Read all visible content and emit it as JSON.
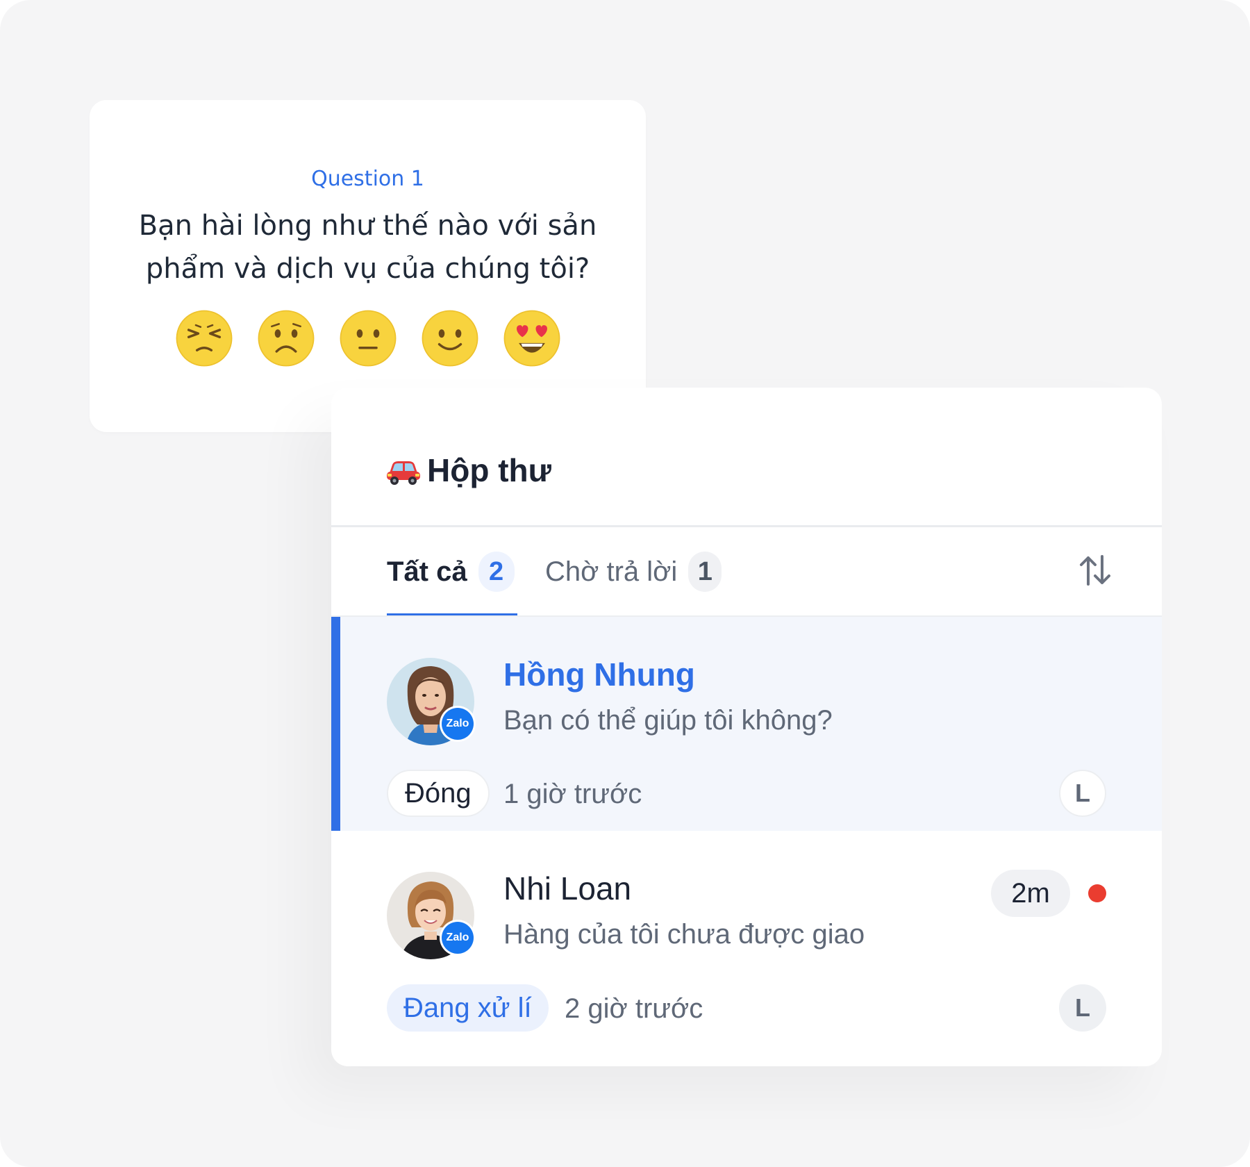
{
  "survey": {
    "question_label": "Question 1",
    "question_text": "Bạn hài lòng như thế nào với sản phẩm và dịch vụ của chúng tôi?",
    "ratings": [
      "persevering-face-icon",
      "frowning-face-icon",
      "neutral-face-icon",
      "slightly-smiling-face-icon",
      "heart-eyes-face-icon"
    ]
  },
  "inbox": {
    "title_icon": "car-icon",
    "title": "Hộp thư",
    "tabs": [
      {
        "label": "Tất cả",
        "count": "2",
        "active": true
      },
      {
        "label": "Chờ trả lời",
        "count": "1",
        "active": false
      }
    ],
    "sort_icon": "sort-arrows-icon",
    "conversations": [
      {
        "name": "Hồng Nhung",
        "preview": "Bạn có thể giúp tôi không?",
        "channel_badge": "Zalo",
        "status": "Đóng",
        "time": "1 giờ trước",
        "assignee": "L",
        "selected": true
      },
      {
        "name": "Nhi Loan",
        "preview": "Hàng của tôi chưa được giao",
        "channel_badge": "Zalo",
        "status": "Đang xử lí",
        "time": "2 giờ trước",
        "assignee": "L",
        "elapsed": "2m",
        "unread": true
      }
    ]
  },
  "colors": {
    "accent": "#2f6fe6",
    "unread_dot": "#ea3d30",
    "selected_row_bg": "#f3f6fc",
    "zalo_blue": "#1677f0"
  }
}
